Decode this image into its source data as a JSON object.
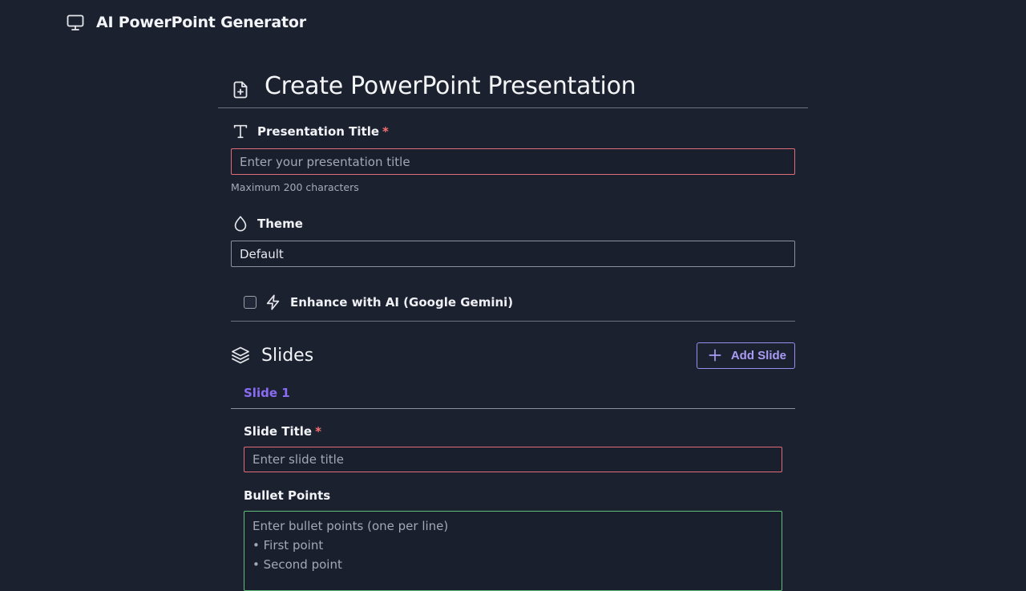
{
  "app": {
    "title": "AI PowerPoint Generator",
    "icon": "monitor-icon"
  },
  "page": {
    "title": "Create PowerPoint Presentation",
    "icon": "file-plus-icon"
  },
  "presentation_title": {
    "label": "Presentation Title",
    "required_mark": "*",
    "placeholder": "Enter your presentation title",
    "value": "",
    "hint": "Maximum 200 characters",
    "icon": "type-icon"
  },
  "theme": {
    "label": "Theme",
    "selected": "Default",
    "icon": "droplet-icon"
  },
  "enhance": {
    "label": "Enhance with AI (Google Gemini)",
    "checked": false,
    "icon": "zap-icon"
  },
  "slides": {
    "title": "Slides",
    "icon": "layers-icon",
    "add_button_label": "Add Slide",
    "add_icon": "plus-icon",
    "tabs": [
      {
        "label": "Slide 1"
      }
    ],
    "slide_title": {
      "label": "Slide Title",
      "required_mark": "*",
      "placeholder": "Enter slide title",
      "value": ""
    },
    "bullet_points": {
      "label": "Bullet Points",
      "placeholder_lines": [
        "Enter bullet points (one per line)",
        "• First point",
        "• Second point"
      ]
    }
  },
  "colors": {
    "background": "#1c2130",
    "accent": "#8b6cf5",
    "error_border": "#e06c7a",
    "valid_border": "#5fbf7a"
  }
}
